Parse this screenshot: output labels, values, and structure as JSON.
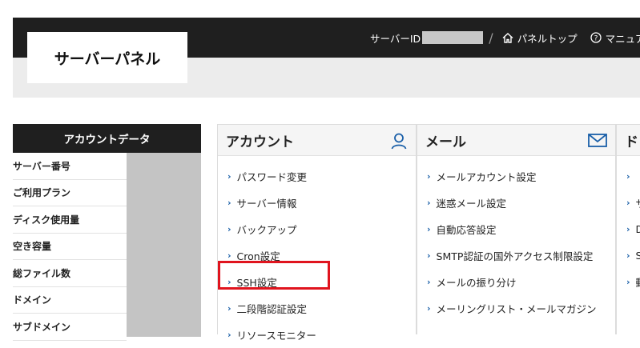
{
  "header": {
    "logo_text": "サーバーパネル",
    "server_id_label": "サーバーID",
    "separator": "/",
    "panel_top_label": "パネルトップ",
    "manual_label": "マニュアル"
  },
  "account_data": {
    "title": "アカウントデータ",
    "rows": [
      "サーバー番号",
      "ご利用プラン",
      "ディスク使用量",
      "空き容量",
      "総ファイル数",
      "ドメイン",
      "サブドメイン"
    ]
  },
  "columns": [
    {
      "title": "アカウント",
      "icon": "user-icon",
      "items": [
        "パスワード変更",
        "サーバー情報",
        "バックアップ",
        "Cron設定",
        "SSH設定",
        "二段階認証設定",
        "リソースモニター"
      ]
    },
    {
      "title": "メール",
      "icon": "mail-icon",
      "items": [
        "メールアカウント設定",
        "迷惑メール設定",
        "自動応答設定",
        "SMTP認証の国外アクセス制限設定",
        "メールの振り分け",
        "メーリングリスト・メールマガジン"
      ]
    },
    {
      "title": "ド",
      "items": [
        "",
        "サ",
        "D",
        "S",
        "動"
      ]
    }
  ],
  "chevron": "›",
  "colors": {
    "topbar": "#1f1f1f",
    "accent": "#1a5fa8",
    "highlight": "#e0141e"
  }
}
